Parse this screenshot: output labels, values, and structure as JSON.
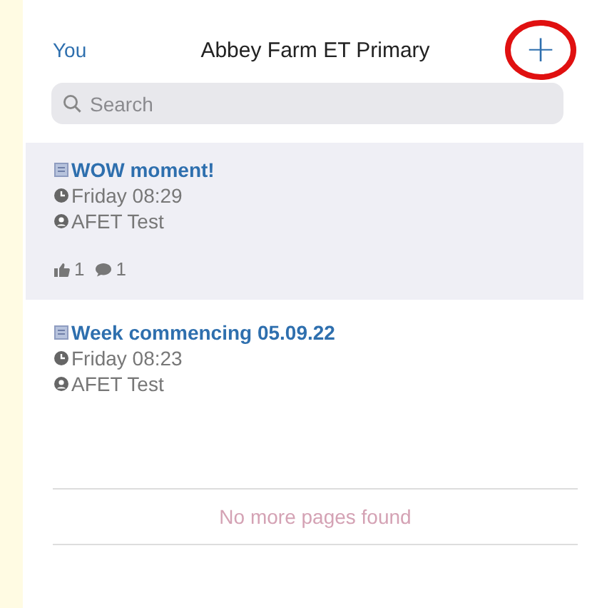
{
  "nav": {
    "back": "You",
    "title": "Abbey Farm ET Primary",
    "add": "+",
    "add_circled": true
  },
  "search": {
    "placeholder": "Search"
  },
  "posts": [
    {
      "title": "WOW moment!",
      "time": "Friday 08:29",
      "author": "AFET Test",
      "selected": true,
      "likes": "1",
      "comments": "1"
    },
    {
      "title": "Week commencing 05.09.22",
      "time": "Friday 08:23",
      "author": "AFET Test",
      "selected": false
    }
  ],
  "footer": "No more pages found"
}
